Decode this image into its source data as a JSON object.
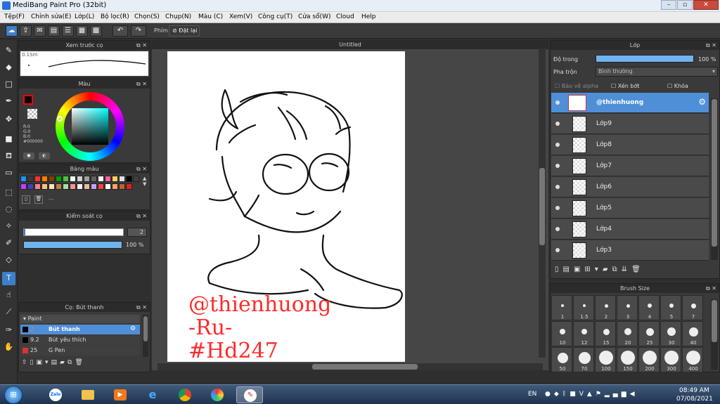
{
  "window": {
    "title": "MediBang Paint Pro (32bit)",
    "minimize": "–",
    "maximize": "▫",
    "close": "✕"
  },
  "menu": [
    "Tệp(F)",
    "Chỉnh sửa(E)",
    "Lớp(L)",
    "Bộ lọc(R)",
    "Chọn(S)",
    "Chụp(N)",
    "Màu (C)",
    "Xem(V)",
    "Công cụ(T)",
    "Cửa sổ(W)",
    "Cloud",
    "Help"
  ],
  "toolbar": {
    "tool_label": "Phím",
    "reset_label": "Đặt lại"
  },
  "preview_panel": {
    "title": "Xem trước cọ",
    "size_text": "0.1Sm"
  },
  "color_panel": {
    "title": "Màu",
    "r": "R:0",
    "g": "G:0",
    "b": "B:0",
    "hex": "#000000",
    "accent": "#ff0000"
  },
  "palette_panel": {
    "title": "Bảng màu",
    "dash": "---"
  },
  "brush_control": {
    "title": "Kiểm soát cọ",
    "size_value": "2",
    "opacity_value": "100 %",
    "opacity_fraction": 1.0
  },
  "brush_list": {
    "title": "Cọ: Bút thanh",
    "group": "Paint",
    "items": [
      {
        "size": "2",
        "name": "Bút thanh",
        "selected": true,
        "color": "#000000"
      },
      {
        "size": "9.2",
        "name": "Bút yêu thích",
        "selected": false,
        "color": "#000000"
      },
      {
        "size": "25",
        "name": "G Pen",
        "selected": false,
        "color": "#e03030"
      }
    ]
  },
  "document": {
    "tab": "Untitled",
    "text_lines": [
      "@thienhuong",
      "-Ru-",
      "#Hd247"
    ],
    "text_color": "#ff2a2a"
  },
  "layer_panel": {
    "title": "Lớp",
    "opacity_label": "Độ trong",
    "opacity_value": "100 %",
    "opacity_fraction": 1.0,
    "blend_label": "Pha trộn",
    "blend_value": "Bình thường",
    "protect_alpha": "Bảo vệ alpha",
    "clipping": "Xén bớt",
    "lock": "Khóa",
    "layers": [
      "@thienhuong",
      "Lớp9",
      "Lớp8",
      "Lớp7",
      "Lớp6",
      "Lớp5",
      "Lớp4",
      "Lớp3"
    ]
  },
  "brush_size_panel": {
    "title": "Brush Size",
    "sizes": [
      "1",
      "1.5",
      "2",
      "3",
      "4",
      "5",
      "7",
      "10",
      "12",
      "15",
      "20",
      "25",
      "30",
      "40",
      "50",
      "70",
      "100",
      "150",
      "200",
      "300",
      "400"
    ]
  },
  "taskbar": {
    "lang": "EN",
    "time": "08:49 AM",
    "date": "07/08/2021",
    "zalo": "Zalo"
  }
}
